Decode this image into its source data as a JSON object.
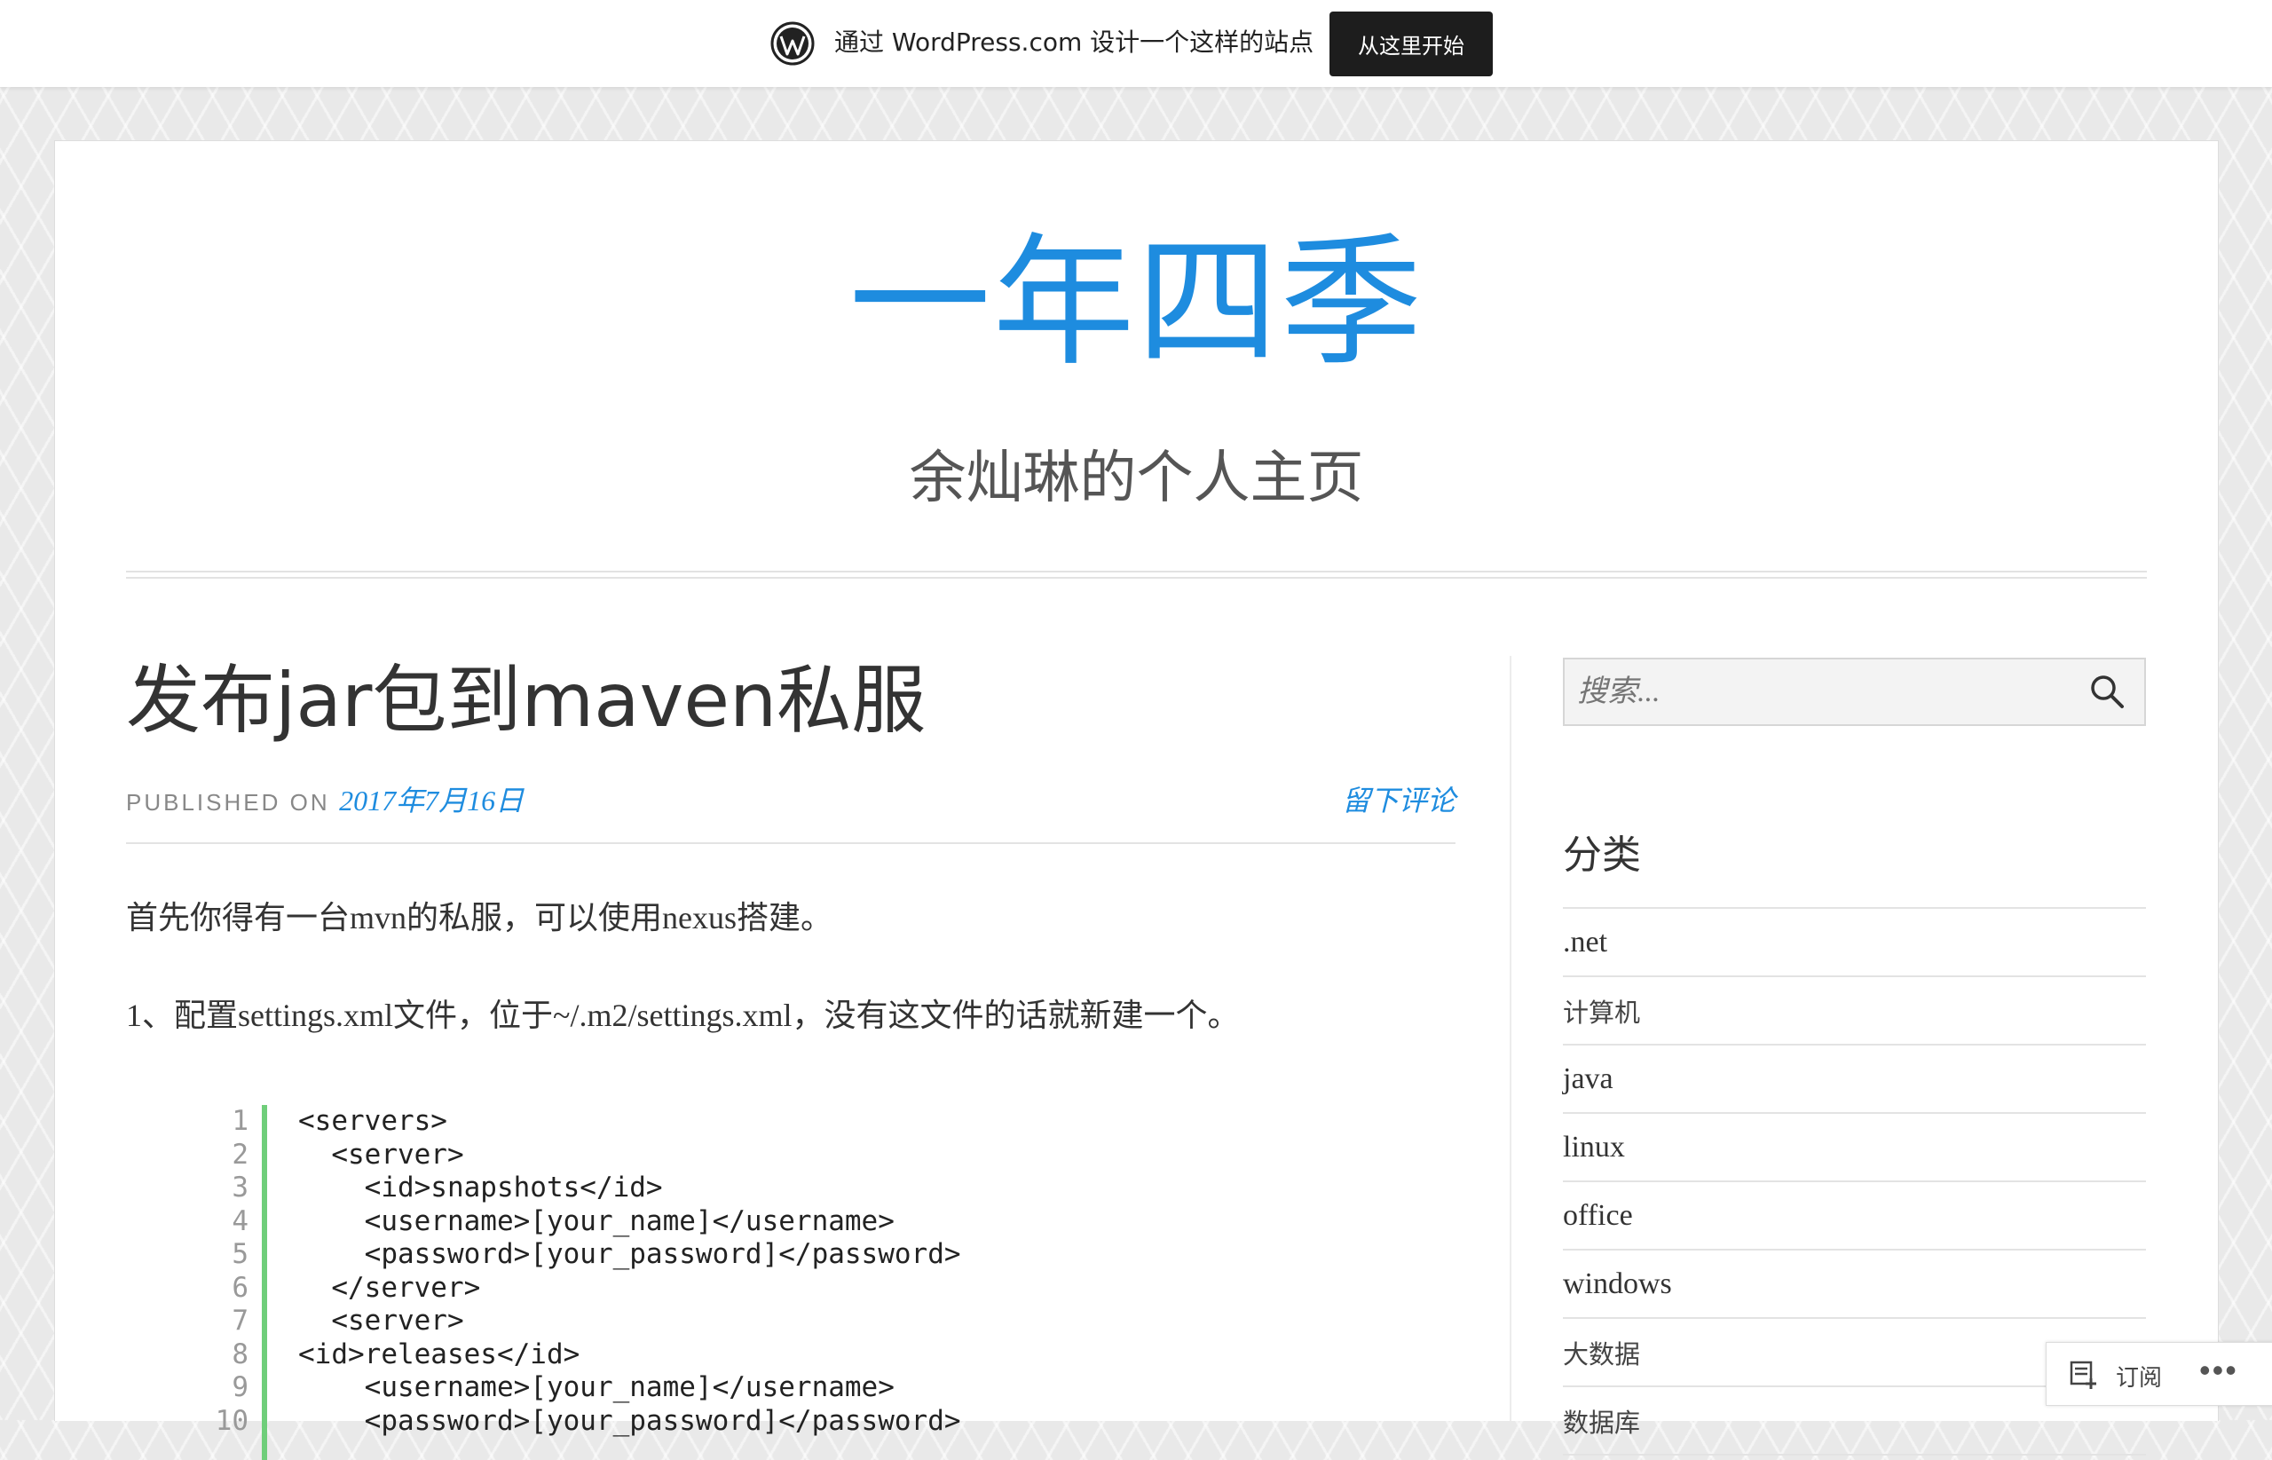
{
  "wp_bar": {
    "text": "通过 WordPress.com 设计一个这样的站点",
    "button": "从这里开始"
  },
  "site": {
    "title": "一年四季",
    "description": "余灿琳的个人主页"
  },
  "post": {
    "title": "发布jar包到maven私服",
    "published_label": "PUBLISHED ON",
    "date": "2017年7月16日",
    "comment_link": "留下评论",
    "paragraphs": [
      "首先你得有一台mvn的私服，可以使用nexus搭建。",
      "1、配置settings.xml文件，位于~/.m2/settings.xml，没有这文件的话就新建一个。"
    ],
    "code_line_numbers": [
      "1",
      "2",
      "3",
      "4",
      "5",
      "6",
      "7",
      "8",
      "9",
      "10"
    ],
    "code_lines": [
      "<servers>",
      "  <server>",
      "    <id>snapshots</id>",
      "    <username>[your_name]</username>",
      "    <password>[your_password]</password>",
      "  </server>",
      "  <server>",
      "<id>releases</id>",
      "    <username>[your_name]</username>",
      "    <password>[your_password]</password>"
    ],
    "accent_color": "#1e8cdf",
    "code_bar_color": "#6fce7a"
  },
  "sidebar": {
    "search_placeholder": "搜索...",
    "categories_title": "分类",
    "categories": [
      ".net",
      "计算机",
      "java",
      "linux",
      "office",
      "windows",
      "大数据",
      "数据库"
    ]
  },
  "follow": {
    "label": "订阅",
    "more": "•••"
  }
}
